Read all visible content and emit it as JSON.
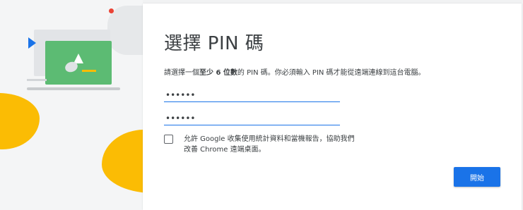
{
  "dialog": {
    "title": "選擇 PIN 碼",
    "description": {
      "prefix": "請選擇一個",
      "bold": "至少 6 位數",
      "suffix": "的 PIN 碼。你必須輸入 PIN 碼才能從遠端連線到這台電腦。"
    },
    "pin_field": {
      "value": "••••••"
    },
    "confirm_pin_field": {
      "value": "••••••"
    },
    "consent_checkbox": {
      "checked": false,
      "label": "允許 Google 收集使用統計資料和當機報告，協助我們改善 Chrome 遠端桌面。"
    },
    "start_button_label": "開始"
  },
  "colors": {
    "accent": "#1a73e8",
    "illustration_green": "#5cbb73",
    "illustration_yellow": "#fbbc04",
    "illustration_red": "#ea4335"
  },
  "icons": {
    "illustration": "laptop-remote-illustration"
  }
}
